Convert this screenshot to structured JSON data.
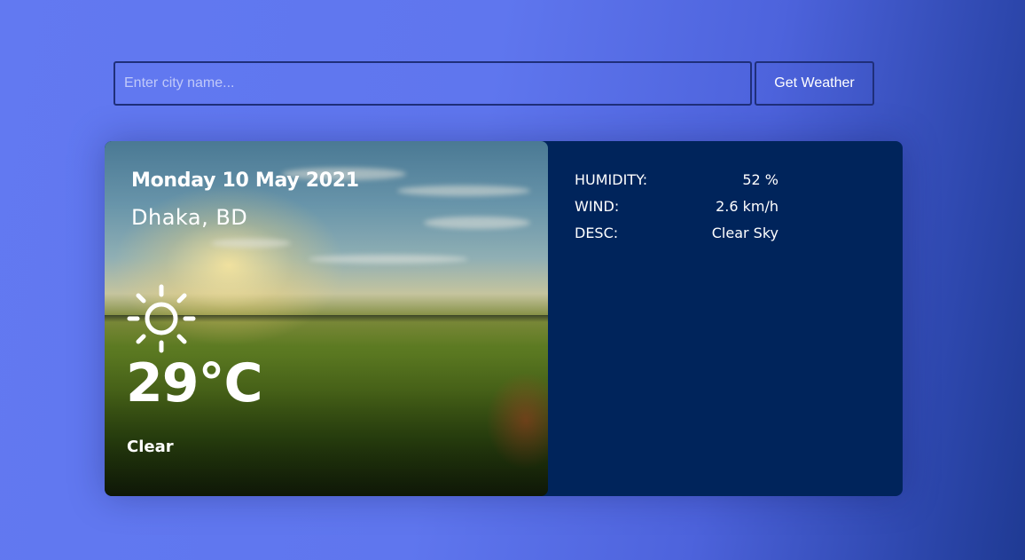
{
  "search": {
    "placeholder": "Enter city name...",
    "value": "",
    "button_label": "Get Weather"
  },
  "weather": {
    "date": "Monday 10 May 2021",
    "location": "Dhaka, BD",
    "icon": "sun-icon",
    "temperature": "29°C",
    "condition": "Clear",
    "details": [
      {
        "label": "HUMIDITY:",
        "value": "52 %"
      },
      {
        "label": "WIND:",
        "value": "2.6 km/h"
      },
      {
        "label": "DESC:",
        "value": "Clear Sky"
      }
    ]
  },
  "colors": {
    "background_start": "#6279f1",
    "background_end": "#1f3a93",
    "details_panel": "#00245b",
    "input_border": "#1f2f7a"
  }
}
